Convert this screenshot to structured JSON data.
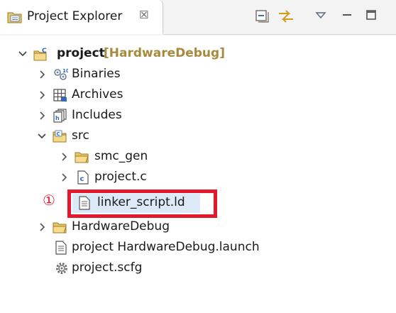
{
  "tab": {
    "title": "Project Explorer",
    "close_glyph": "☒"
  },
  "toolbar": {
    "buttons": [
      "collapse-all-icon",
      "link-with-editor-icon",
      "view-menu-icon",
      "minimize-icon",
      "maximize-icon"
    ]
  },
  "tree": {
    "project": {
      "name": "project",
      "config": "[HardwareDebug]"
    },
    "items": [
      {
        "label": "Binaries"
      },
      {
        "label": "Archives"
      },
      {
        "label": "Includes"
      },
      {
        "label": "src"
      },
      {
        "label": "smc_gen"
      },
      {
        "label": "project.c"
      },
      {
        "label": "linker_script.ld"
      },
      {
        "label": "HardwareDebug"
      },
      {
        "label": "project HardwareDebug.launch"
      },
      {
        "label": "project.scfg"
      }
    ]
  },
  "annotation": {
    "marker": "①",
    "color": "#e3182a"
  },
  "colors": {
    "selection": "#dce9f8",
    "decoration": "#a88a3c"
  }
}
